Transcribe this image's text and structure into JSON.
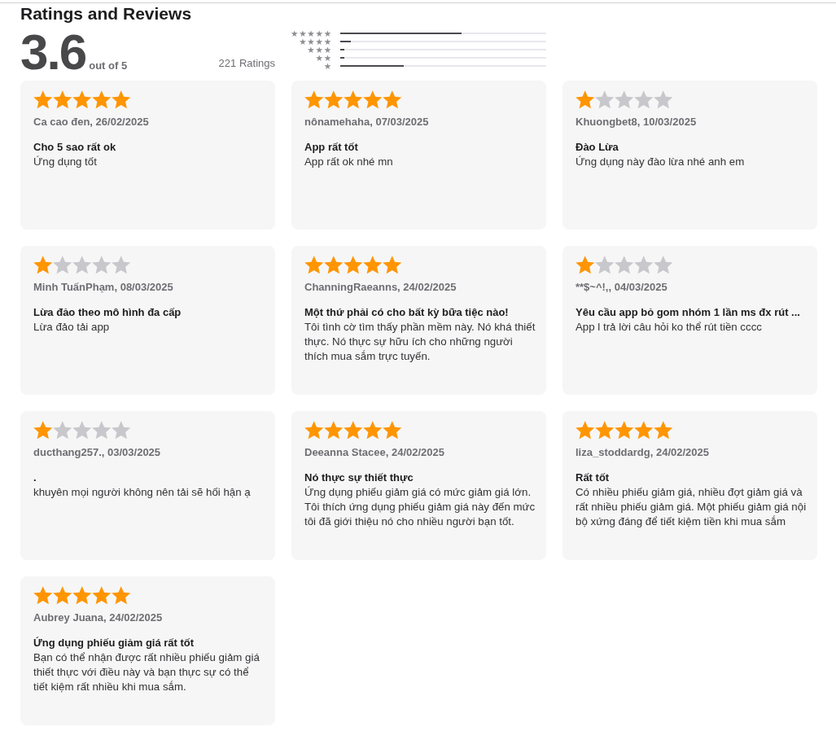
{
  "heading": "Ratings and Reviews",
  "summary": {
    "score": "3.6",
    "out_of": "out of 5",
    "count": "221 Ratings"
  },
  "histogram": [
    {
      "label": "★★★★★",
      "level": 0.59
    },
    {
      "label": "★★★★",
      "level": 0.05
    },
    {
      "label": "★★★",
      "level": 0.02
    },
    {
      "label": "★★",
      "level": 0.02
    },
    {
      "label": "★",
      "level": 0.31
    }
  ],
  "reviews": [
    {
      "stars": 5,
      "byline": "Ca cao đen, 26/02/2025",
      "title": "Cho 5 sao rất ok",
      "body": "Ứng dụng tốt"
    },
    {
      "stars": 5,
      "byline": "nônamehaha, 07/03/2025",
      "title": "App rất tốt",
      "body": "App rất ok nhé mn"
    },
    {
      "stars": 1,
      "byline": "Khuongbet8, 10/03/2025",
      "title": "Đào Lừa",
      "body": "Ứng dụng này đào lừa nhé anh em"
    },
    {
      "stars": 1,
      "byline": "Minh TuấnPhạm, 08/03/2025",
      "title": "Lừa đảo theo mô hình đa cấp",
      "body": "Lừa đảo tải app"
    },
    {
      "stars": 5,
      "byline": "ChanningRaeanns, 24/02/2025",
      "title": "Một thứ phải có cho bất kỳ bữa tiệc nào!",
      "body": "Tôi tình cờ tìm thấy phần mềm này. Nó khá thiết thực. Nó thực sự hữu ích cho những người thích mua sắm trực tuyến."
    },
    {
      "stars": 1,
      "byline": "**$~^!,, 04/03/2025",
      "title": "Yêu cầu app bỏ gom nhóm 1 lần ms đx rút ...",
      "body": "App l trả lời câu hỏi ko thể rút tiền cccc"
    },
    {
      "stars": 1,
      "byline": "ducthang257., 03/03/2025",
      "title": ".",
      "body": "khuyên mọi người không nên tải sẽ hối hận ạ"
    },
    {
      "stars": 5,
      "byline": "Deeanna Stacee, 24/02/2025",
      "title": "Nó thực sự thiết thực",
      "body": "Ứng dụng phiếu giảm giá có mức giảm giá lớn. Tôi thích ứng dụng phiếu giảm giá này đến mức tôi đã giới thiệu nó cho nhiều người bạn tốt."
    },
    {
      "stars": 5,
      "byline": "liza_stoddardg, 24/02/2025",
      "title": "Rất tốt",
      "body": "Có nhiều phiếu giảm giá, nhiều đợt giảm giá và rất nhiều phiếu giảm giá. Một phiếu giảm giá nội bộ xứng đáng để tiết kiệm tiền khi mua sắm"
    },
    {
      "stars": 5,
      "byline": "Aubrey Juana, 24/02/2025",
      "title": "Ứng dụng phiếu giảm giá rất tốt",
      "body": "Bạn có thể nhận được rất nhiều phiếu giảm giá thiết thực với điều này và bạn thực sự có thể tiết kiệm rất nhiều khi mua sắm."
    }
  ]
}
